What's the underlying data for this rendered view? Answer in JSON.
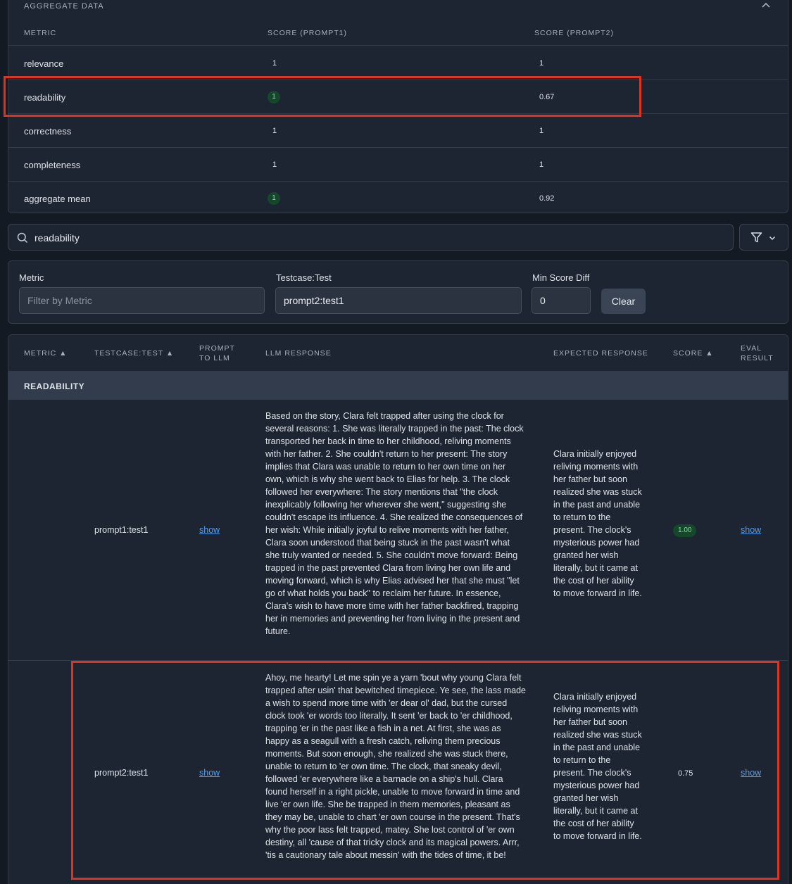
{
  "aggregate": {
    "title": "AGGREGATE DATA",
    "headers": {
      "metric": "METRIC",
      "score1": "SCORE (PROMPT1)",
      "score2": "SCORE (PROMPT2)"
    },
    "rows": [
      {
        "metric": "relevance",
        "score1": "1",
        "score2": "1",
        "best": false
      },
      {
        "metric": "readability",
        "score1": "1",
        "score2": "0.67",
        "best": true
      },
      {
        "metric": "correctness",
        "score1": "1",
        "score2": "1",
        "best": false
      },
      {
        "metric": "completeness",
        "score1": "1",
        "score2": "1",
        "best": false
      },
      {
        "metric": "aggregate mean",
        "score1": "1",
        "score2": "0.92",
        "best": true
      }
    ]
  },
  "search": {
    "query": "readability"
  },
  "filters": {
    "metric_label": "Metric",
    "metric_placeholder": "Filter by Metric",
    "testcase_label": "Testcase:Test",
    "testcase_value": "prompt2:test1",
    "min_diff_label": "Min Score Diff",
    "min_diff_value": "0",
    "clear_label": "Clear"
  },
  "results": {
    "headers": {
      "metric": "METRIC ▲",
      "testcase": "TESTCASE:TEST ▲",
      "prompt_l1": "PROMPT",
      "prompt_l2": "TO LLM",
      "llm": "LLM RESPONSE",
      "expected": "EXPECTED RESPONSE",
      "score": "SCORE ▲",
      "eval_l1": "EVAL",
      "eval_l2": "RESULT"
    },
    "group": "READABILITY",
    "rows": [
      {
        "testcase": "prompt1:test1",
        "prompt_link": "show",
        "llm_response": "Based on the story, Clara felt trapped after using the clock for several reasons: 1. She was literally trapped in the past: The clock transported her back in time to her childhood, reliving moments with her father. 2. She couldn't return to her present: The story implies that Clara was unable to return to her own time on her own, which is why she went back to Elias for help. 3. The clock followed her everywhere: The story mentions that \"the clock inexplicably following her wherever she went,\" suggesting she couldn't escape its influence. 4. She realized the consequences of her wish: While initially joyful to relive moments with her father, Clara soon understood that being stuck in the past wasn't what she truly wanted or needed. 5. She couldn't move forward: Being trapped in the past prevented Clara from living her own life and moving forward, which is why Elias advised her that she must \"let go of what holds you back\" to reclaim her future. In essence, Clara's wish to have more time with her father backfired, trapping her in memories and preventing her from living in the present and future.",
        "expected": "Clara initially enjoyed reliving moments with her father but soon realized she was stuck in the past and unable to return to the present. The clock's mysterious power had granted her wish literally, but it came at the cost of her ability to move forward in life.",
        "score": "1.00",
        "score_best": true,
        "eval_link": "show"
      },
      {
        "testcase": "prompt2:test1",
        "prompt_link": "show",
        "llm_response": "Ahoy, me hearty! Let me spin ye a yarn 'bout why young Clara felt trapped after usin' that bewitched timepiece. Ye see, the lass made a wish to spend more time with 'er dear ol' dad, but the cursed clock took 'er words too literally. It sent 'er back to 'er childhood, trapping 'er in the past like a fish in a net. At first, she was as happy as a seagull with a fresh catch, reliving them precious moments. But soon enough, she realized she was stuck there, unable to return to 'er own time. The clock, that sneaky devil, followed 'er everywhere like a barnacle on a ship's hull. Clara found herself in a right pickle, unable to move forward in time and live 'er own life. She be trapped in them memories, pleasant as they may be, unable to chart 'er own course in the present. That's why the poor lass felt trapped, matey. She lost control of 'er own destiny, all 'cause of that tricky clock and its magical powers. Arrr, 'tis a cautionary tale about messin' with the tides of time, it be!",
        "expected": "Clara initially enjoyed reliving moments with her father but soon realized she was stuck in the past and unable to return to the present. The clock's mysterious power had granted her wish literally, but it came at the cost of her ability to move forward in life.",
        "score": "0.75",
        "score_best": false,
        "eval_link": "show"
      }
    ]
  },
  "colors": {
    "background": "#141a24",
    "panel": "#1d2532",
    "group_row": "#323c4c",
    "best_pill_bg": "#16472b",
    "best_pill_text": "#7fe0a0",
    "link": "#5a9be6",
    "highlight": "#e0331f"
  }
}
